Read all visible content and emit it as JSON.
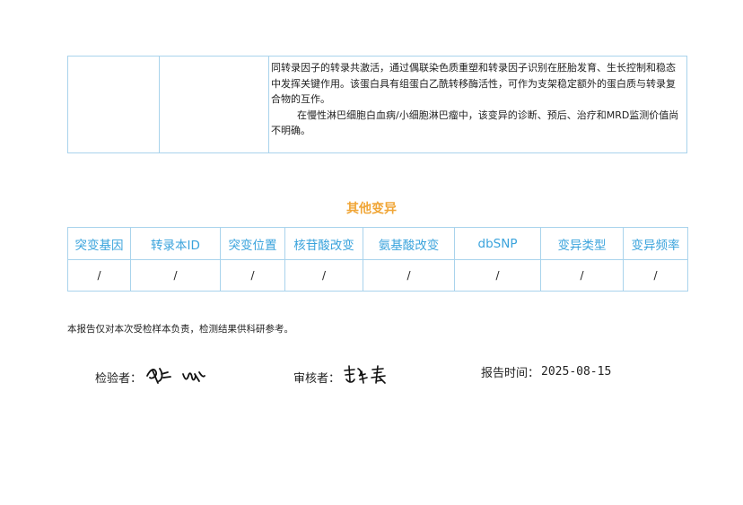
{
  "top_table": {
    "col1": "",
    "col2": "",
    "paragraph1": "同转录因子的转录共激活，通过偶联染色质重塑和转录因子识别在胚胎发育、生长控制和稳态中发挥关键作用。该蛋白具有组蛋白乙酰转移酶活性，可作为支架稳定额外的蛋白质与转录复合物的互作。",
    "paragraph2": "在慢性淋巴细胞白血病/小细胞淋巴瘤中，该变异的诊断、预后、治疗和MRD监测价值尚不明确。"
  },
  "other_variants": {
    "title": "其他变异",
    "headers": [
      "突变基因",
      "转录本ID",
      "突变位置",
      "核苷酸改变",
      "氨基酸改变",
      "dbSNP",
      "变异类型",
      "变异频率"
    ],
    "row": [
      "/",
      "/",
      "/",
      "/",
      "/",
      "/",
      "/",
      "/"
    ]
  },
  "disclaimer": "本报告仅对本次受检样本负责，检测结果供科研参考。",
  "signatures": {
    "inspector_label": "检验者：",
    "inspector_signature": "handwritten signature",
    "reviewer_label": "审核者：",
    "reviewer_signature": "handwritten signature",
    "report_time_label": "报告时间：",
    "report_time_value": "2025-08-15"
  },
  "colors": {
    "border": "#a9d3ec",
    "header_text": "#3aa3dc",
    "section_title": "#f0a637"
  }
}
